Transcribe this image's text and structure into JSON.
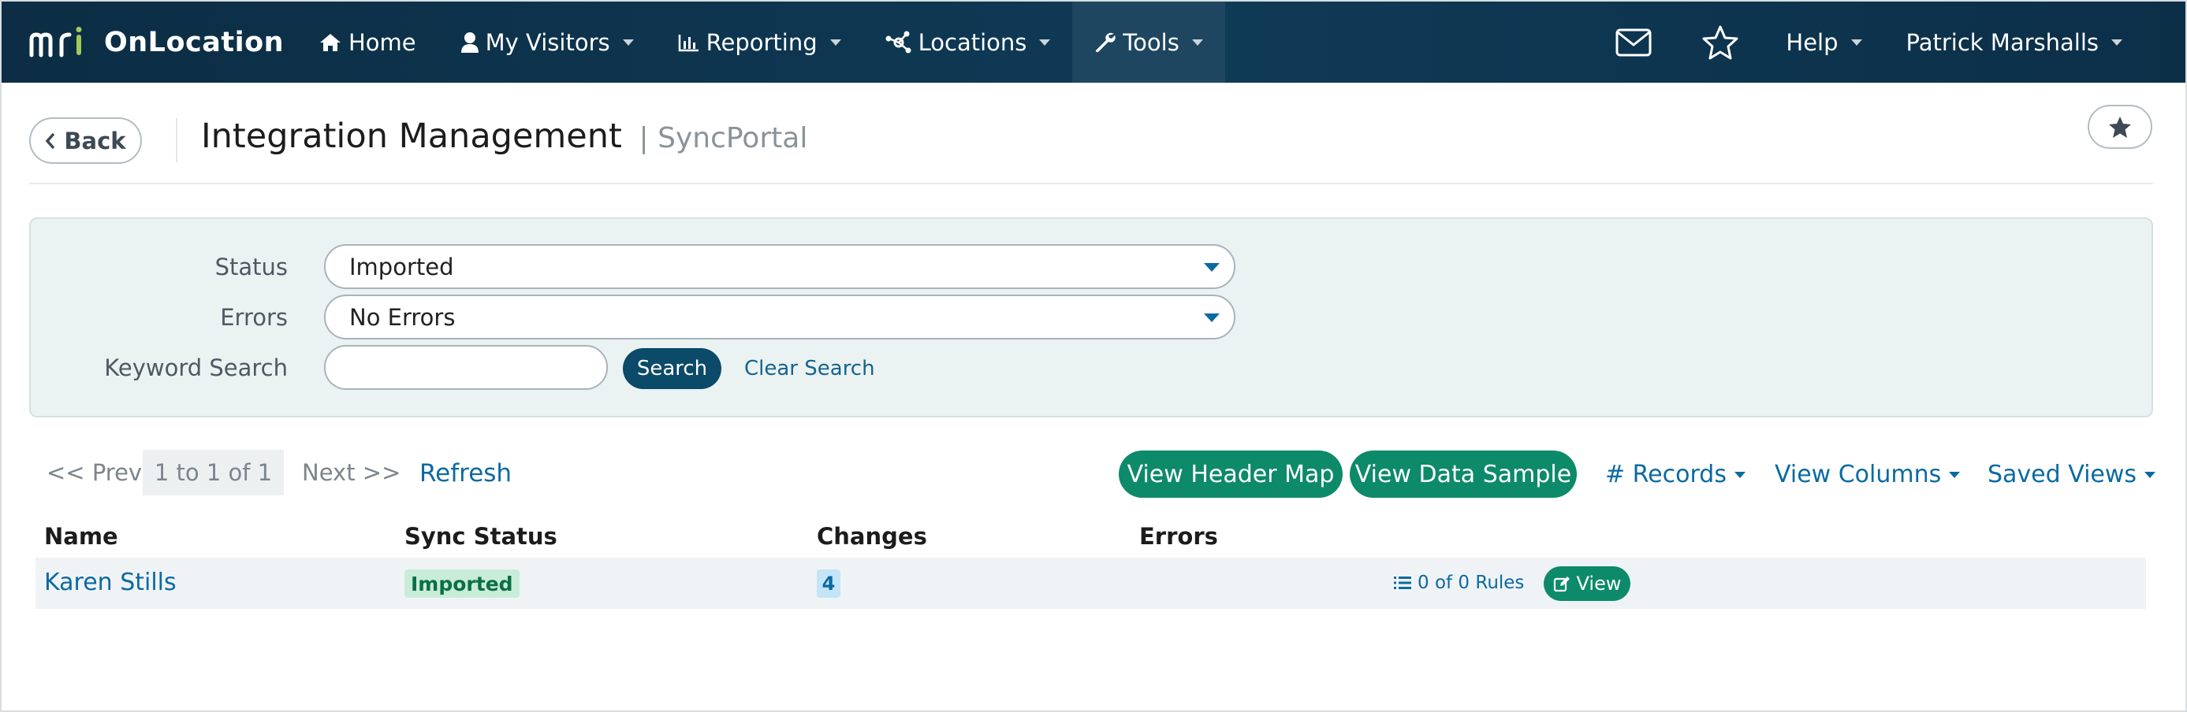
{
  "brand": {
    "logo_text": "mri",
    "name": "OnLocation"
  },
  "nav": {
    "items": [
      {
        "label": "Home",
        "icon": "home-icon"
      },
      {
        "label": "My Visitors",
        "icon": "user-icon"
      },
      {
        "label": "Reporting",
        "icon": "bar-chart-icon"
      },
      {
        "label": "Locations",
        "icon": "network-icon"
      },
      {
        "label": "Tools",
        "icon": "wrench-icon"
      }
    ],
    "active": "Tools",
    "help_label": "Help",
    "user_label": "Patrick Marshalls"
  },
  "header": {
    "back_label": "Back",
    "title": "Integration Management",
    "subtitle": "| SyncPortal"
  },
  "filters": {
    "status_label": "Status",
    "status_value": "Imported",
    "errors_label": "Errors",
    "errors_value": "No Errors",
    "keyword_label": "Keyword Search",
    "keyword_value": "",
    "search_button": "Search",
    "clear_link": "Clear Search"
  },
  "pager": {
    "prev": "<< Prev",
    "range": "1 to 1 of 1",
    "next": "Next >>",
    "refresh": "Refresh"
  },
  "actions": {
    "view_header_map": "View Header Map",
    "view_data_sample": "View Data Sample",
    "records": "# Records",
    "view_columns": "View Columns",
    "saved_views": "Saved Views"
  },
  "table": {
    "columns": [
      "Name",
      "Sync Status",
      "Changes",
      "Errors"
    ],
    "rows": [
      {
        "name": "Karen Stills",
        "sync_status": "Imported",
        "changes": "4",
        "rules": "0 of 0 Rules",
        "view": "View"
      }
    ]
  },
  "colors": {
    "navbar": "#0f3a56",
    "primary_link": "#0a6aa1",
    "green_button": "#0d8a6a",
    "search_button": "#0b4a68",
    "filter_panel": "#ebf2f2"
  }
}
